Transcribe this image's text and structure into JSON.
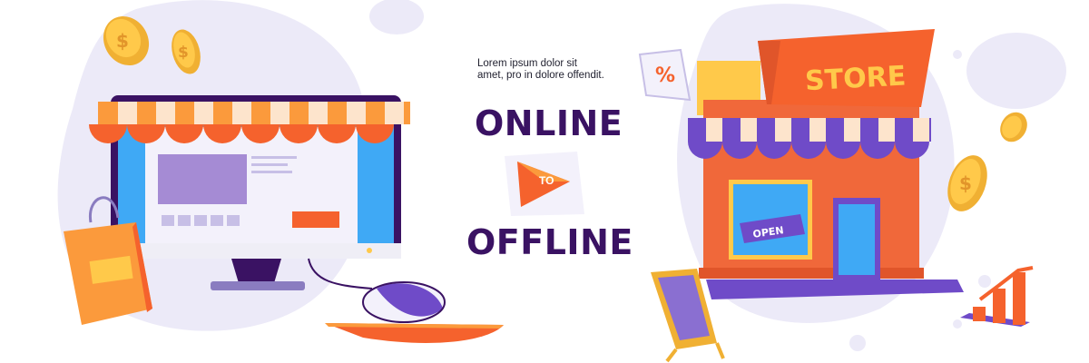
{
  "tagline": "Lorem ipsum dolor sit amet, pro in dolore offendit.",
  "headline_top": "ONLINE",
  "connector": "TO",
  "headline_bottom": "OFFLINE",
  "store_sign": "STORE",
  "open_sign": "OPEN",
  "discount_tag": "%",
  "colors": {
    "purple_dark": "#3a1263",
    "purple": "#6f4bc8",
    "orange": "#f5622d",
    "orange_light": "#fb9a3c",
    "yellow": "#ffc94a",
    "blob": "#eceaf8",
    "screen_blue": "#3fa9f5",
    "brick": "#f0683a"
  }
}
